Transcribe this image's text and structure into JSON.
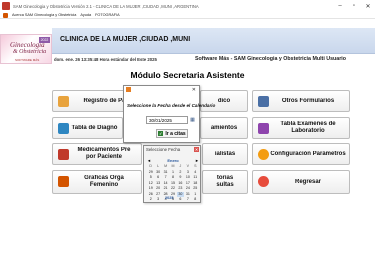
{
  "titlebar": {
    "title": "SAM Ginecologia y Obstetricia Versión 2.1 - CLINICA DE LA MUJER ,CIUDAD ,MUNI ,ARGENTINA"
  },
  "menu": {
    "items": [
      "Acerca SAM Ginecologia y Obstetricia",
      "Ayuda",
      "FOTOGRAFIA"
    ]
  },
  "logo": {
    "line1": "Ginecología",
    "line2": "& Obstetricia",
    "line3": "SOFTWARE MÁS",
    "badge": "2022"
  },
  "header": {
    "clinic": "CLINICA DE LA MUJER ,CIUDAD ,MUNI",
    "datetime": "dom. ene. 26 13:35:48 Hora estándar del Este 2025",
    "software": "Software Más - SAM Ginecologia y Obstetricia Multi Usuario"
  },
  "page_title": "Módulo Secretaria Asistente",
  "buttons": {
    "registro": "Registro de Paci",
    "medico": "dico",
    "otros": "Otros Formularios",
    "diagnostico": "Tabla de Diagnó",
    "tratamientos": "amientos",
    "tabla_examenes_1": "Tabla Exámenes de",
    "tabla_examenes_2": "Laboratorio",
    "medicamentos_1": "Medicamentos Pre",
    "medicamentos_2": "por Paciente",
    "especialistas": "ialistas",
    "configuracion": "Configuración Parámetros",
    "graficas_1": "Graficas Orga",
    "graficas_2": "Femenino",
    "consultas_1": "torias",
    "consultas_2": "sultas",
    "regresar": "Regresar"
  },
  "dialog": {
    "prompt": "Seleccione la Fecha desde el Calendario",
    "date_value": "30/01/2025",
    "ok_label": "Ir a citas"
  },
  "picker": {
    "title": "Seleccione Fecha",
    "month": "Enero",
    "year": "2025",
    "prev": "◄",
    "next": "►",
    "weekdays": [
      "D",
      "L",
      "M",
      "M",
      "J",
      "V",
      "S"
    ],
    "days": [
      "29",
      "30",
      "31",
      "1",
      "2",
      "3",
      "4",
      "5",
      "6",
      "7",
      "8",
      "9",
      "10",
      "11",
      "12",
      "13",
      "14",
      "15",
      "16",
      "17",
      "18",
      "19",
      "20",
      "21",
      "22",
      "23",
      "24",
      "25",
      "26",
      "27",
      "28",
      "29",
      "30",
      "31",
      "1",
      "2",
      "3",
      "4",
      "5",
      "6",
      "7",
      "8"
    ],
    "selected_day": "30"
  },
  "colors": {
    "banner": "#c9d7ec",
    "accent": "#24549b"
  }
}
